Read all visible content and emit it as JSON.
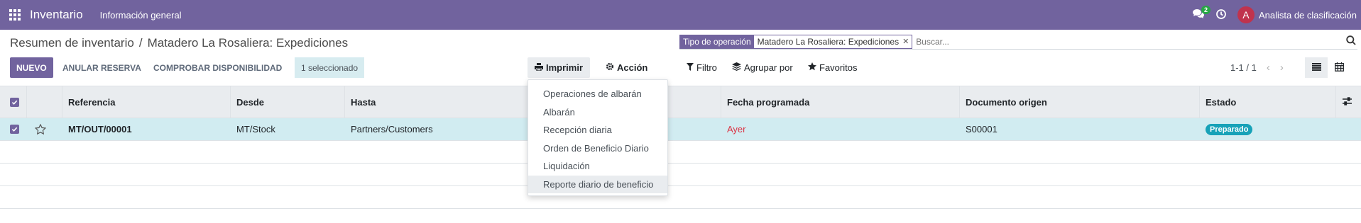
{
  "navbar": {
    "app_name": "Inventario",
    "menu_item": "Información general",
    "message_count": "2",
    "avatar_letter": "A",
    "user_name": "Analista de clasificación"
  },
  "breadcrumb": {
    "parent": "Resumen de inventario",
    "separator": "/",
    "current": "Matadero La Rosaliera: Expediciones"
  },
  "search": {
    "facet_label": "Tipo de operación",
    "facet_value": "Matadero La Rosaliera: Expediciones",
    "placeholder": "Buscar..."
  },
  "toolbar": {
    "new_label": "NUEVO",
    "unreserve_label": "ANULAR RESERVA",
    "check_label": "COMPROBAR DISPONIBILIDAD",
    "selected_label": "1 seleccionado",
    "print_label": "Imprimir",
    "action_label": "Acción",
    "filter_label": "Filtro",
    "group_label": "Agrupar por",
    "favorites_label": "Favoritos",
    "pager_value": "1-1 / 1"
  },
  "table": {
    "columns": [
      "Referencia",
      "Desde",
      "Hasta",
      "Fecha programada",
      "Documento origen",
      "Estado"
    ],
    "rows": [
      {
        "reference": "MT/OUT/00001",
        "from": "MT/Stock",
        "to": "Partners/Customers",
        "scheduled": "Ayer",
        "origin": "S00001",
        "state": "Preparado"
      }
    ]
  },
  "print_menu": {
    "items": [
      "Operaciones de albarán",
      "Albarán",
      "Recepción diaria",
      "Orden de Beneficio Diario",
      "Liquidación",
      "Reporte diario de beneficio"
    ]
  },
  "colors": {
    "brand": "#71639e",
    "selected_row": "#d1ecf1",
    "status_badge": "#17a2b8",
    "overdue": "#dc3545"
  }
}
